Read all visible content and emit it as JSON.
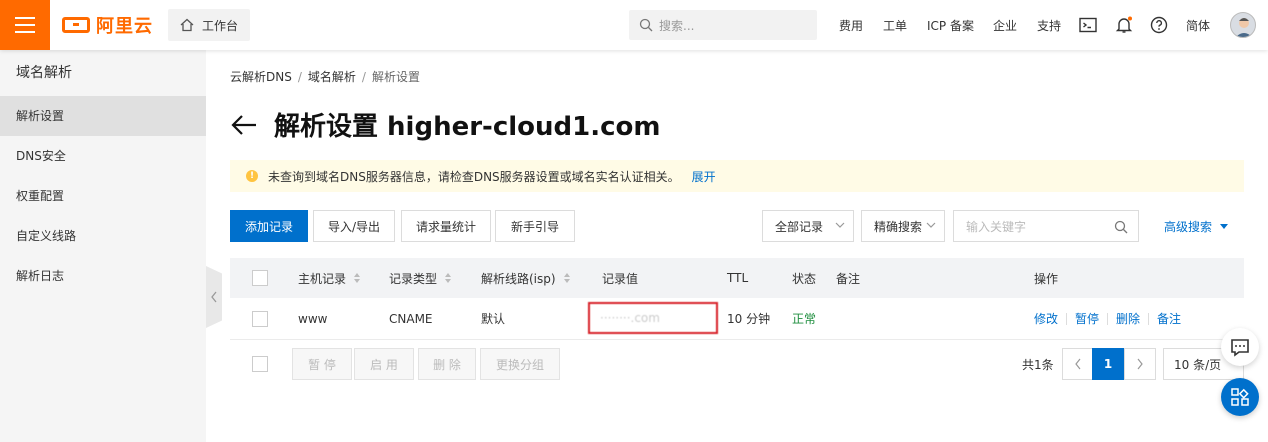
{
  "header": {
    "logo_text": "阿里云",
    "workbench_label": "工作台",
    "search_placeholder": "搜索...",
    "nav": [
      "费用",
      "工单",
      "ICP 备案",
      "企业",
      "支持"
    ],
    "language": "简体"
  },
  "sidebar": {
    "title": "域名解析",
    "items": [
      {
        "label": "解析设置",
        "active": true
      },
      {
        "label": "DNS安全"
      },
      {
        "label": "权重配置"
      },
      {
        "label": "自定义线路"
      },
      {
        "label": "解析日志"
      }
    ]
  },
  "breadcrumb": [
    "云解析DNS",
    "域名解析",
    "解析设置"
  ],
  "page_title": "解析设置 higher-cloud1.com",
  "notice": {
    "text": "未查询到域名DNS服务器信息，请检查DNS服务器设置或域名实名认证相关。",
    "link": "展开"
  },
  "toolbar": {
    "add": "添加记录",
    "import_export": "导入/导出",
    "request_stats": "请求量统计",
    "guide": "新手引导",
    "record_filter": "全部记录",
    "search_mode": "精确搜索",
    "keyword_placeholder": "输入关键字",
    "advanced_search": "高级搜索"
  },
  "table": {
    "columns": [
      "主机记录",
      "记录类型",
      "解析线路(isp)",
      "记录值",
      "TTL",
      "状态",
      "备注",
      "操作"
    ],
    "rows": [
      {
        "host": "www",
        "type": "CNAME",
        "line": "默认",
        "value": "········.com",
        "ttl": "10 分钟",
        "status": "正常",
        "remark": "",
        "actions": [
          "修改",
          "暂停",
          "删除",
          "备注"
        ]
      }
    ]
  },
  "batch": [
    "暂 停",
    "启 用",
    "删 除",
    "更换分组"
  ],
  "pager": {
    "total": "共1条",
    "current": "1",
    "page_size": "10 条/页"
  },
  "colors": {
    "brand": "#ff6a00",
    "primary": "#0070cc",
    "ok": "#1e8e3e",
    "highlight": "#d8232a"
  }
}
